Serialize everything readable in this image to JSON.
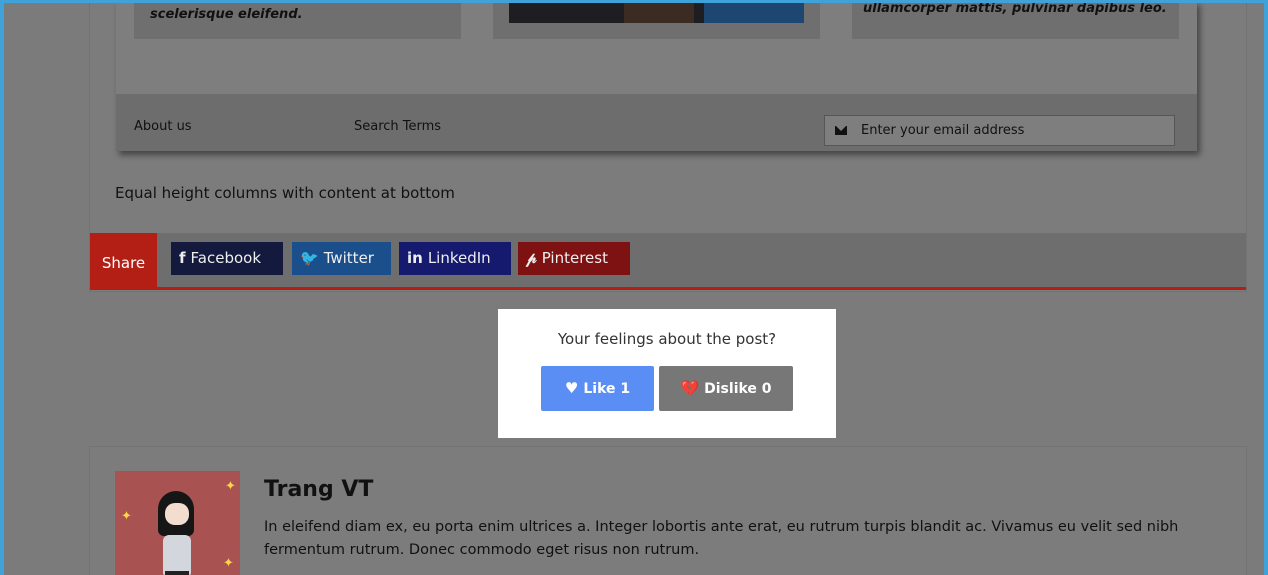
{
  "demo": {
    "card1_text": "scelerisque eleifend.",
    "card3_text": "ullamcorper mattis, pulvinar dapibus leo.",
    "footer": {
      "about_label": "About us",
      "search_terms_label": "Search Terms",
      "email_placeholder": "Enter your email address"
    }
  },
  "caption": "Equal height columns with content at bottom",
  "share": {
    "label": "Share",
    "buttons": [
      {
        "icon": "f",
        "label": "Facebook"
      },
      {
        "icon": "🐦",
        "label": "Twitter"
      },
      {
        "icon": "in",
        "label": "LinkedIn"
      },
      {
        "icon": "𝓅",
        "label": "Pinterest"
      }
    ]
  },
  "feelings": {
    "question": "Your feelings about the post?",
    "like_label": "Like 1",
    "dislike_label": "Dislike 0",
    "like_icon": "♥",
    "dislike_icon": "💔"
  },
  "author": {
    "name": "Trang VT",
    "bio": "In eleifend diam ex, eu porta enim ultrices a. Integer lobortis ante erat, eu rutrum turpis blandit ac. Vivamus eu velit sed nibh fermentum rutrum. Donec commodo eget risus non rutrum."
  },
  "colors": {
    "overlay": "#7b7b7b",
    "accent_red": "#b31f15",
    "like_blue": "#5b8ef5",
    "frame_blue": "#3fa2d8"
  }
}
